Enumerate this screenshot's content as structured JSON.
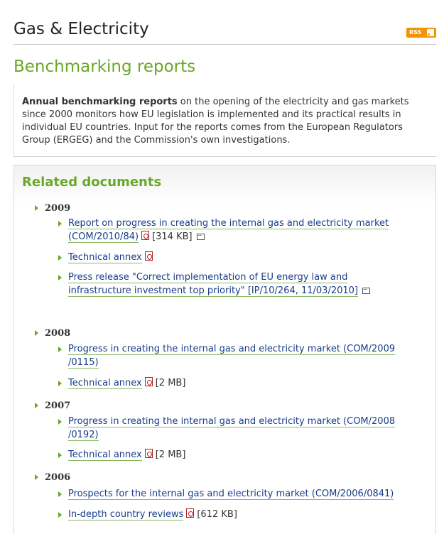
{
  "header": {
    "site_title": "Gas & Electricity",
    "rss_label": "RSS"
  },
  "page_title": "Benchmarking reports",
  "intro": {
    "bold": "Annual benchmarking reports",
    "text": " on the opening of the electricity and gas markets since 2000 monitors how EU legislation is implemented and its practical results in individual EU countries. Input for the reports comes from the European Regulators Group (ERGEG) and the Commission's own investigations."
  },
  "related": {
    "title": "Related documents",
    "years": [
      {
        "year": "2009",
        "docs": [
          {
            "label": "Report on progress in creating the internal gas and electricity market (COM/2010/84)",
            "size": "[314 KB]"
          },
          {
            "label": "Technical annex"
          },
          {
            "label": "Press release \"Correct implementation of EU energy law and infrastructure investment top priority\" [IP/10/264, 11/03/2010]"
          }
        ]
      },
      {
        "year": "2008",
        "docs": [
          {
            "label": "Progress in creating the internal gas and electricity market (COM/2009 /0115)"
          },
          {
            "label": "Technical annex",
            "size": "[2 MB]"
          }
        ]
      },
      {
        "year": "2007",
        "docs": [
          {
            "label": "Progress in creating the internal gas and electricity market (COM/2008 /0192)"
          },
          {
            "label": "Technical annex",
            "size": "[2 MB]"
          }
        ]
      },
      {
        "year": "2006",
        "docs": [
          {
            "label": "Prospects for the internal gas and electricity market (COM/2006/0841)"
          },
          {
            "label": "In-depth country reviews",
            "size": "[612 KB]"
          }
        ]
      }
    ]
  },
  "colors": {
    "accent_green": "#6aa727",
    "link_blue": "#1a3c8a",
    "rss_orange": "#f29300"
  }
}
